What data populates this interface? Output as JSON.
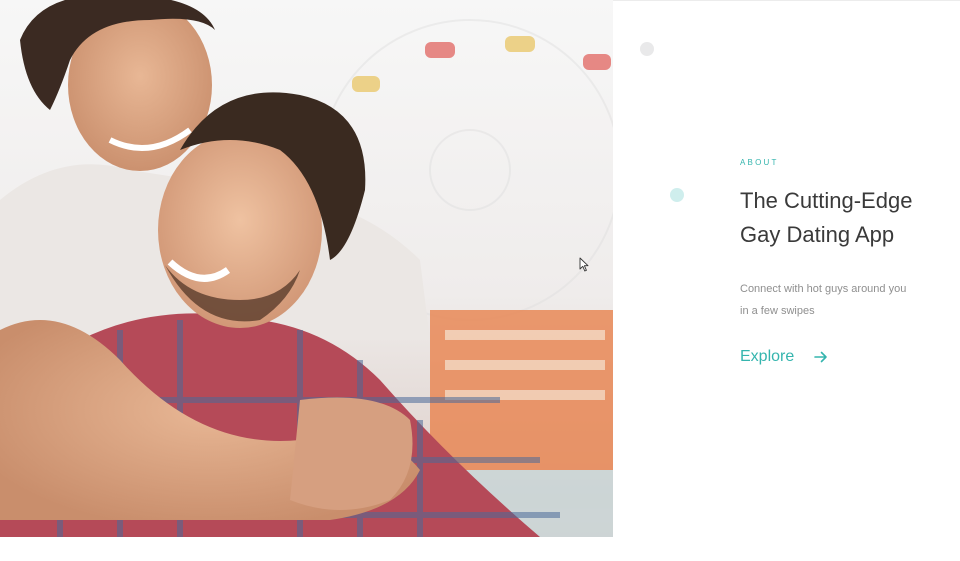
{
  "hero": {
    "image_alt": "Two smiling men embracing at a fair with a ferris wheel in the background"
  },
  "about": {
    "eyebrow": "ABOUT",
    "headline_line1": "The Cutting-Edge",
    "headline_line2": "Gay Dating App",
    "description_line1": "Connect with hot guys around you",
    "description_line2": "in a few swipes",
    "cta_label": "Explore",
    "cta_icon": "arrow-right-icon"
  },
  "colors": {
    "accent": "#35b5ae",
    "headline": "#3a3a3a",
    "body_text": "#8f8f8f"
  }
}
